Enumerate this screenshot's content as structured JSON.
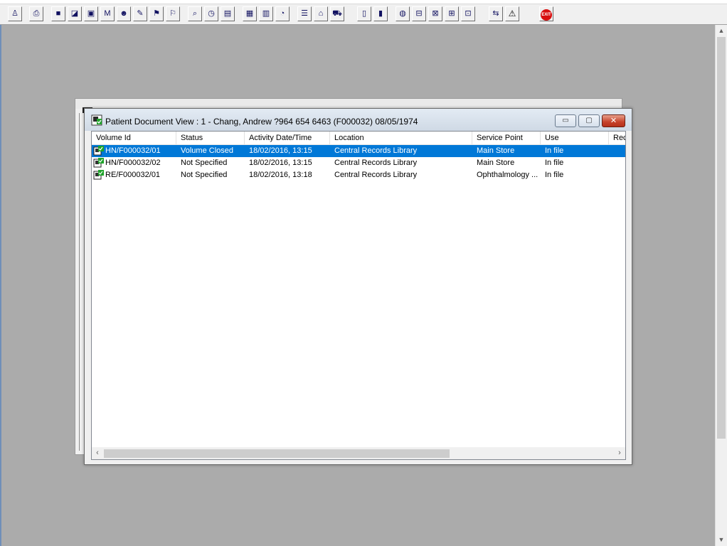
{
  "toolbar": {
    "buttons": [
      {
        "id": "patient",
        "icon": "patient-person-icon",
        "glyph": "♙"
      },
      {
        "id": "print",
        "icon": "printer-icon",
        "glyph": "⎙"
      },
      {
        "id": "book",
        "icon": "book-icon",
        "glyph": "■"
      },
      {
        "id": "folder",
        "icon": "folder-edit-icon",
        "glyph": "◪"
      },
      {
        "id": "monitor",
        "icon": "monitor-search-icon",
        "glyph": "▣"
      },
      {
        "id": "m",
        "icon": "m-letter-icon",
        "glyph": "M"
      },
      {
        "id": "doctor",
        "icon": "clinician-icon",
        "glyph": "☻"
      },
      {
        "id": "note",
        "icon": "notepad-pen-icon",
        "glyph": "✎"
      },
      {
        "id": "flag1",
        "icon": "flag-icon",
        "glyph": "⚑"
      },
      {
        "id": "flag2",
        "icon": "flag-outline-icon",
        "glyph": "⚐"
      },
      {
        "id": "search",
        "icon": "magnifier-icon",
        "glyph": "⌕"
      },
      {
        "id": "clock",
        "icon": "clock-icon",
        "glyph": "◷"
      },
      {
        "id": "screen",
        "icon": "screen-list-icon",
        "glyph": "▤"
      },
      {
        "id": "chart1",
        "icon": "chart-monitor-icon",
        "glyph": "▦"
      },
      {
        "id": "docs",
        "icon": "documents-icon",
        "glyph": "▥"
      },
      {
        "id": "gauge",
        "icon": "gauge-icon",
        "glyph": "◔"
      },
      {
        "id": "list",
        "icon": "list-yellow-icon",
        "glyph": "☰"
      },
      {
        "id": "bed",
        "icon": "bed-icon",
        "glyph": "⌂"
      },
      {
        "id": "ambulance",
        "icon": "transport-icon",
        "glyph": "⛟"
      },
      {
        "id": "page",
        "icon": "blank-page-icon",
        "glyph": "▯"
      },
      {
        "id": "bars",
        "icon": "bar-chart-icon",
        "glyph": "▮"
      },
      {
        "id": "globe",
        "icon": "globe-arrow-icon",
        "glyph": "◍"
      },
      {
        "id": "inbox1",
        "icon": "inbox-icon",
        "glyph": "⊟"
      },
      {
        "id": "inbox2",
        "icon": "inbox-down-icon",
        "glyph": "⊠"
      },
      {
        "id": "inbox3",
        "icon": "inbox-green-icon",
        "glyph": "⊞"
      },
      {
        "id": "inbox4",
        "icon": "inbox-transfer-icon",
        "glyph": "⊡"
      },
      {
        "id": "swap",
        "icon": "swap-arrows-icon",
        "glyph": "⇆"
      },
      {
        "id": "warning",
        "icon": "warning-triangle-icon",
        "glyph": "⚠"
      },
      {
        "id": "exit",
        "icon": "exit-stop-icon",
        "glyph": "EXIT"
      }
    ]
  },
  "window": {
    "title": "Patient Document View : 1 - Chang, Andrew ?964 654 6463 (F000032) 08/05/1974",
    "minimize_glyph": "▭",
    "maximize_glyph": "▢",
    "close_glyph": "✕"
  },
  "listview": {
    "columns": [
      "Volume Id",
      "Status",
      "Activity Date/Time",
      "Location",
      "Service Point",
      "Use",
      "Rec"
    ],
    "rows": [
      [
        "HN/F000032/01",
        "Volume Closed",
        "18/02/2016, 13:15",
        "Central Records Library",
        "Main Store",
        "In file"
      ],
      [
        "HN/F000032/02",
        "Not Specified",
        "18/02/2016, 13:15",
        "Central Records Library",
        "Main Store",
        "In file"
      ],
      [
        "RE/F000032/01",
        "Not Specified",
        "18/02/2016, 13:18",
        "Central Records Library",
        "Ophthalmology ...",
        "In file"
      ]
    ],
    "selected_row": 0,
    "scroll_left_glyph": "‹",
    "scroll_right_glyph": "›"
  },
  "page_scroll": {
    "up_glyph": "▲",
    "down_glyph": "▼"
  },
  "colors": {
    "selection": "#0078d7",
    "desktop": "#ababab",
    "close_button": "#c6412a"
  }
}
